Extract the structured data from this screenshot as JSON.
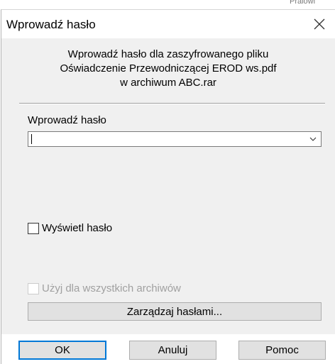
{
  "background_window": {
    "peek_text": "Praiowi"
  },
  "dialog": {
    "title": "Wprowadź hasło",
    "close_symbol": "×",
    "message": {
      "line1": "Wprowadź hasło dla zaszyfrowanego pliku",
      "line2": "Oświadczenie Przewodniczącej EROD ws.pdf",
      "line3": "w archiwum ABC.rar"
    },
    "password_label": "Wprowadź hasło",
    "password_value": "",
    "show_password_label": "Wyświetl hasło",
    "show_password_checked": false,
    "use_for_all_label": "Użyj dla wszystkich archiwów",
    "use_for_all_checked": false,
    "use_for_all_enabled": false,
    "manage_button": "Zarządzaj hasłami...",
    "buttons": {
      "ok": "OK",
      "cancel": "Anuluj",
      "help": "Pomoc"
    }
  },
  "colors": {
    "body_background": "#f0f0f0",
    "button_face": "#e1e1e1",
    "button_border": "#adadad",
    "default_button_border": "#0078d7",
    "disabled_text": "#a0a0a0"
  },
  "icons": {
    "close": "close-icon",
    "dropdown": "chevron-down-icon"
  }
}
